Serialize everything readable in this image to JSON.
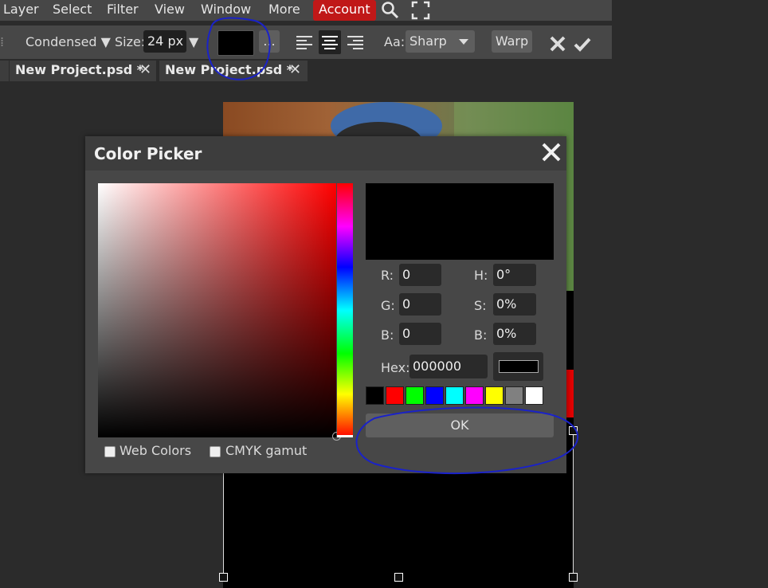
{
  "menubar": {
    "items": [
      "Layer",
      "Select",
      "Filter",
      "View",
      "Window",
      "More"
    ],
    "account_label": "Account"
  },
  "toolbar": {
    "font_label": "Condensed ▼",
    "size_label": "Size:",
    "size_value": "24 px",
    "size_arrow": "▼",
    "more_label": "...",
    "aa_label": "Aa:",
    "aa_value": "Sharp",
    "warp_label": "Warp",
    "color": "#000000"
  },
  "tabs": [
    {
      "label": "New Project.psd *"
    },
    {
      "label": "New Project.psd *"
    }
  ],
  "dialog": {
    "title": "Color Picker",
    "r_label": "R:",
    "r_value": "0",
    "g_label": "G:",
    "g_value": "0",
    "b_label": "B:",
    "b_value": "0",
    "h_label": "H:",
    "h_value": "0°",
    "s_label": "S:",
    "s_value": "0%",
    "bv_label": "B:",
    "bv_value": "0%",
    "hex_label": "Hex:",
    "hex_value": "000000",
    "ok_label": "OK",
    "web_colors_label": "Web Colors",
    "cmyk_label": "CMYK gamut",
    "swatches": [
      "#000000",
      "#ff0000",
      "#00ff00",
      "#0000ff",
      "#00ffff",
      "#ff00ff",
      "#ffff00",
      "#808080",
      "#ffffff"
    ]
  },
  "accent": "#c01818"
}
